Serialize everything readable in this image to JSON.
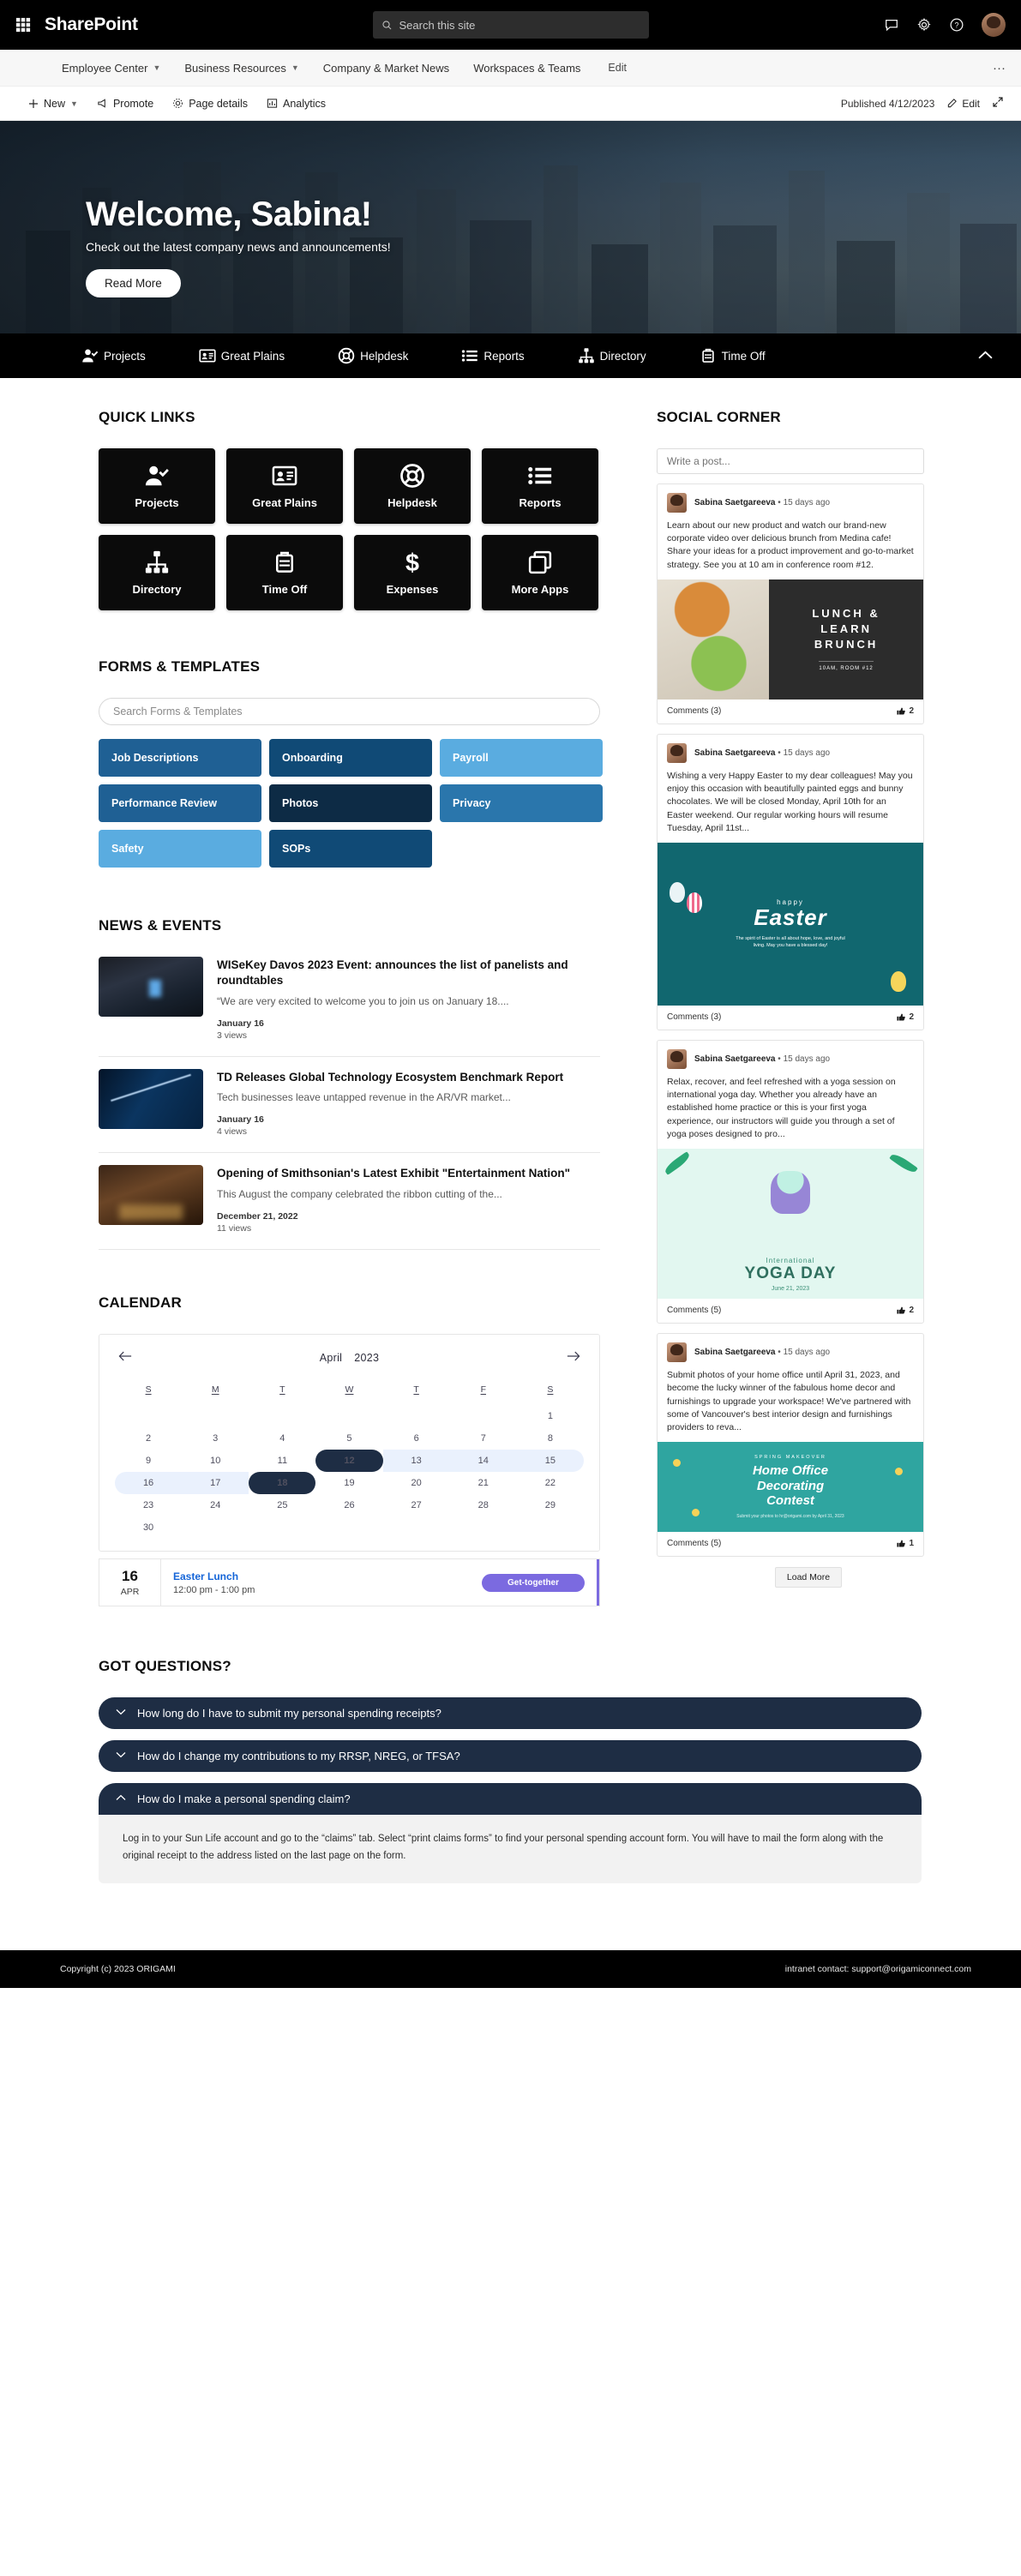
{
  "suitebar": {
    "app_name": "SharePoint",
    "search_placeholder": "Search this site",
    "icons": [
      "sharepoint-waffle-icon",
      "chat-icon",
      "settings-gear-icon",
      "help-icon",
      "user-avatar"
    ]
  },
  "sitenav": {
    "items": [
      {
        "label": "Employee Center",
        "has_chevron": true
      },
      {
        "label": "Business Resources",
        "has_chevron": true
      },
      {
        "label": "Company & Market News",
        "has_chevron": false
      },
      {
        "label": "Workspaces & Teams",
        "has_chevron": false
      }
    ],
    "edit_label": "Edit",
    "overflow": "···"
  },
  "commandbar": {
    "new_label": "New",
    "promote_label": "Promote",
    "page_details_label": "Page details",
    "analytics_label": "Analytics",
    "published_label": "Published 4/12/2023",
    "edit_label": "Edit"
  },
  "hero": {
    "title": "Welcome, Sabina!",
    "subtitle": "Check out the latest company news and announcements!",
    "button": "Read More"
  },
  "iconnav": {
    "items": [
      {
        "label": "Projects",
        "icon": "person-check-icon"
      },
      {
        "label": "Great Plains",
        "icon": "contact-card-icon"
      },
      {
        "label": "Helpdesk",
        "icon": "lifesaver-icon"
      },
      {
        "label": "Reports",
        "icon": "list-icon"
      },
      {
        "label": "Directory",
        "icon": "org-chart-icon"
      },
      {
        "label": "Time Off",
        "icon": "suitcase-icon"
      }
    ],
    "collapse_icon": "chevron-up-icon"
  },
  "quick_links": {
    "heading": "QUICK LINKS",
    "tiles": [
      {
        "label": "Projects",
        "icon": "person-check-icon"
      },
      {
        "label": "Great Plains",
        "icon": "contact-card-icon"
      },
      {
        "label": "Helpdesk",
        "icon": "lifesaver-icon"
      },
      {
        "label": "Reports",
        "icon": "list-icon"
      },
      {
        "label": "Directory",
        "icon": "org-chart-icon"
      },
      {
        "label": "Time Off",
        "icon": "suitcase-icon"
      },
      {
        "label": "Expenses",
        "icon": "dollar-icon"
      },
      {
        "label": "More Apps",
        "icon": "apps-stack-icon"
      }
    ]
  },
  "forms": {
    "heading": "FORMS & TEMPLATES",
    "search_placeholder": "Search Forms & Templates",
    "search_value": "",
    "tiles": [
      {
        "label": "Job Descriptions",
        "color": "#1f6094"
      },
      {
        "label": "Onboarding",
        "color": "#104a76"
      },
      {
        "label": "Payroll",
        "color": "#5aace0"
      },
      {
        "label": "Performance Review",
        "color": "#1f6094"
      },
      {
        "label": "Photos",
        "color": "#0d2b45"
      },
      {
        "label": "Privacy",
        "color": "#2a76ac"
      },
      {
        "label": "Safety",
        "color": "#5aace0"
      },
      {
        "label": "SOPs",
        "color": "#104a76"
      }
    ]
  },
  "news": {
    "heading": "NEWS & EVENTS",
    "items": [
      {
        "title": "WISeKey Davos 2023 Event: announces the list of panelists and roundtables",
        "desc": "“We are very excited to welcome you to join us on January 18....",
        "date": "January 16",
        "views": "3 views",
        "thumb": "conference-hall-photo"
      },
      {
        "title": "TD Releases Global Technology Ecosystem Benchmark Report",
        "desc": "Tech businesses leave untapped revenue in the AR/VR market...",
        "date": "January 16",
        "views": "4 views",
        "thumb": "stock-chart-photo"
      },
      {
        "title": "Opening of Smithsonian's Latest Exhibit \"Entertainment Nation\"",
        "desc": "This August the company celebrated the ribbon cutting of the...",
        "date": "December 21, 2022",
        "views": "11 views",
        "thumb": "party-gathering-photo"
      }
    ]
  },
  "calendar": {
    "heading": "CALENDAR",
    "month": "April",
    "year": "2023",
    "prev_icon": "arrow-left-icon",
    "next_icon": "arrow-right-icon",
    "weekdays": [
      "S",
      "M",
      "T",
      "W",
      "T",
      "F",
      "S"
    ],
    "weeks": [
      [
        null,
        null,
        null,
        null,
        null,
        null,
        1
      ],
      [
        2,
        3,
        4,
        5,
        6,
        7,
        8
      ],
      [
        9,
        10,
        11,
        12,
        13,
        14,
        15
      ],
      [
        16,
        17,
        18,
        19,
        20,
        21,
        22
      ],
      [
        23,
        24,
        25,
        26,
        27,
        28,
        29
      ],
      [
        30,
        null,
        null,
        null,
        null,
        null,
        null
      ]
    ],
    "selected_days": [
      12,
      18
    ],
    "range_days": [
      13,
      14,
      15,
      16,
      17
    ],
    "event": {
      "day": "16",
      "month": "APR",
      "title": "Easter Lunch",
      "time": "12:00 pm - 1:00 pm",
      "tag": "Get-together"
    }
  },
  "social": {
    "heading": "SOCIAL CORNER",
    "post_placeholder": "Write a post...",
    "post_value": "",
    "load_more": "Load More",
    "posts": [
      {
        "author": "Sabina Saetgareeva",
        "separator": "•",
        "time": "15 days ago",
        "text": "Learn about our new product and watch our brand-new corporate video over delicious brunch from Medina cafe! Share your ideas for a product improvement and go-to-market strategy. See you at 10 am in conference room #12.",
        "image": "lunch-and-learn-brunch-poster",
        "image_text": {
          "line1": "LUNCH &",
          "line2": "LEARN",
          "line3": "BRUNCH",
          "caption": "10AM, ROOM #12"
        },
        "comments": "Comments (3)",
        "likes": "2"
      },
      {
        "author": "Sabina Saetgareeva",
        "separator": "•",
        "time": "15 days ago",
        "text": "Wishing a very Happy Easter to my dear colleagues! May you enjoy this occasion with beautifully painted eggs and bunny chocolates. We will be closed Monday, April 10th for an Easter weekend. Our regular working hours will resume Tuesday, April 11st...",
        "image": "happy-easter-poster",
        "image_text": {
          "line1": "happy",
          "line2": "Easter",
          "caption": "The spirit of Easter is all about hope, love, and joyful living. May you have a blessed day!"
        },
        "comments": "Comments (3)",
        "likes": "2"
      },
      {
        "author": "Sabina Saetgareeva",
        "separator": "•",
        "time": "15 days ago",
        "text": "Relax, recover, and feel refreshed with a yoga session on international yoga day. Whether you already have an established home practice or this is your first yoga experience, our instructors will guide you through a set of yoga poses designed to pro...",
        "image": "international-yoga-day-poster",
        "image_text": {
          "line1": "International",
          "line2": "YOGA DAY",
          "caption": "June 21, 2023"
        },
        "comments": "Comments (5)",
        "likes": "2"
      },
      {
        "author": "Sabina Saetgareeva",
        "separator": "•",
        "time": "15 days ago",
        "text": "Submit photos of your home office until April 31, 2023, and become the lucky winner of the fabulous home decor and furnishings to upgrade your workspace! We've partnered with some of Vancouver's best interior design and furnishings providers to reva...",
        "image": "home-office-decorating-contest-poster",
        "image_text": {
          "line1": "SPRING MAKEOVER",
          "line2": "Home Office",
          "line3": "Decorating",
          "line4": "Contest",
          "caption": "Submit your photos to hr@origami.com by April 31, 2023"
        },
        "comments": "Comments (5)",
        "likes": "1"
      }
    ]
  },
  "faq": {
    "heading": "GOT QUESTIONS?",
    "items": [
      {
        "question": "How long do I have to submit my personal spending receipts?",
        "open": false,
        "chevron": "chevron-down-icon",
        "answer": ""
      },
      {
        "question": "How do I change my contributions to my RRSP, NREG, or TFSA?",
        "open": false,
        "chevron": "chevron-down-icon",
        "answer": ""
      },
      {
        "question": "How do I make a personal spending claim?",
        "open": true,
        "chevron": "chevron-up-icon",
        "answer": "Log in to your Sun Life account and go to the “claims” tab. Select “print claims forms” to find your personal spending account form. You will have to mail the form along with the original receipt to the address listed on the last page on the form."
      }
    ]
  },
  "footer": {
    "copyright": "Copyright (c) 2023 ORIGAMI",
    "contact": "intranet contact: support@origamiconnect.com"
  }
}
